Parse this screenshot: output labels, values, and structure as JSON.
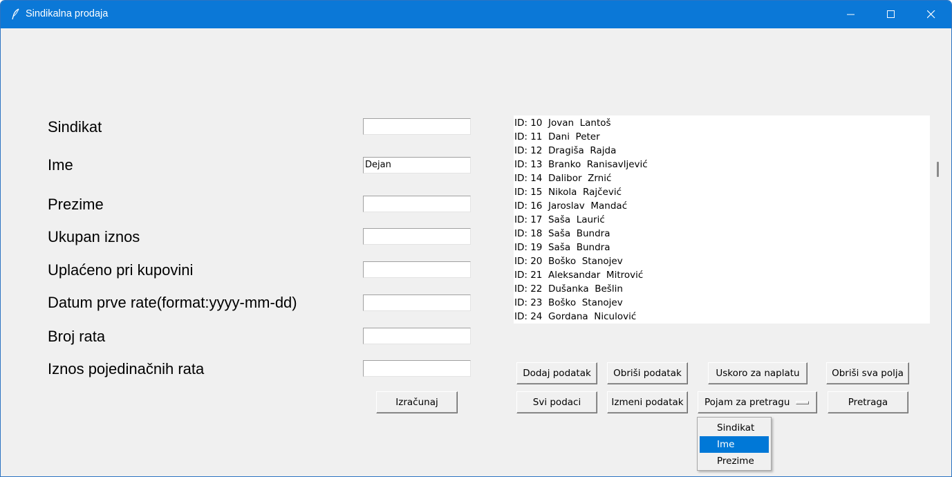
{
  "window": {
    "title": "Sindikalna prodaja",
    "titlebar_color": "#0b78d7",
    "controls": [
      "minimize-icon",
      "maximize-icon",
      "close-icon"
    ]
  },
  "form": {
    "fields": [
      {
        "label": "Sindikat",
        "value": ""
      },
      {
        "label": "Ime",
        "value": "Dejan"
      },
      {
        "label": "Prezime",
        "value": ""
      },
      {
        "label": "Ukupan iznos",
        "value": ""
      },
      {
        "label": "Uplaćeno pri kupovini",
        "value": ""
      },
      {
        "label": "Datum prve rate(format:yyyy-mm-dd)",
        "value": ""
      },
      {
        "label": "Broj rata",
        "value": ""
      },
      {
        "label": "Iznos pojedinačnih rata",
        "value": ""
      }
    ],
    "calculate_label": "Izračunaj"
  },
  "records": [
    "ID: 10  Jovan  Lantoš",
    "ID: 11  Dani  Peter",
    "ID: 12  Dragiša  Rajda",
    "ID: 13  Branko  Ranisavljević",
    "ID: 14  Dalibor  Zrnić",
    "ID: 15  Nikola  Rajčević",
    "ID: 16  Jaroslav  Mandać",
    "ID: 17  Saša  Laurić",
    "ID: 18  Saša  Bundra",
    "ID: 19  Saša  Bundra",
    "ID: 20  Boško  Stanojev",
    "ID: 21  Aleksandar  Mitrović",
    "ID: 22  Dušanka  Bešlin",
    "ID: 23  Boško  Stanojev",
    "ID: 24  Gordana  Niculović"
  ],
  "buttons": {
    "add": "Dodaj podatak",
    "delete": "Obriši podatak",
    "due_soon": "Uskoro za naplatu",
    "clear_all": "Obriši sva polja",
    "all_data": "Svi podaci",
    "edit": "Izmeni podatak",
    "search": "Pretraga"
  },
  "search_term": {
    "selected_label": "Pojam za pretragu",
    "options": [
      "Sindikat",
      "Ime",
      "Prezime"
    ],
    "highlighted_option": "Ime",
    "highlight_color": "#0078d7"
  }
}
